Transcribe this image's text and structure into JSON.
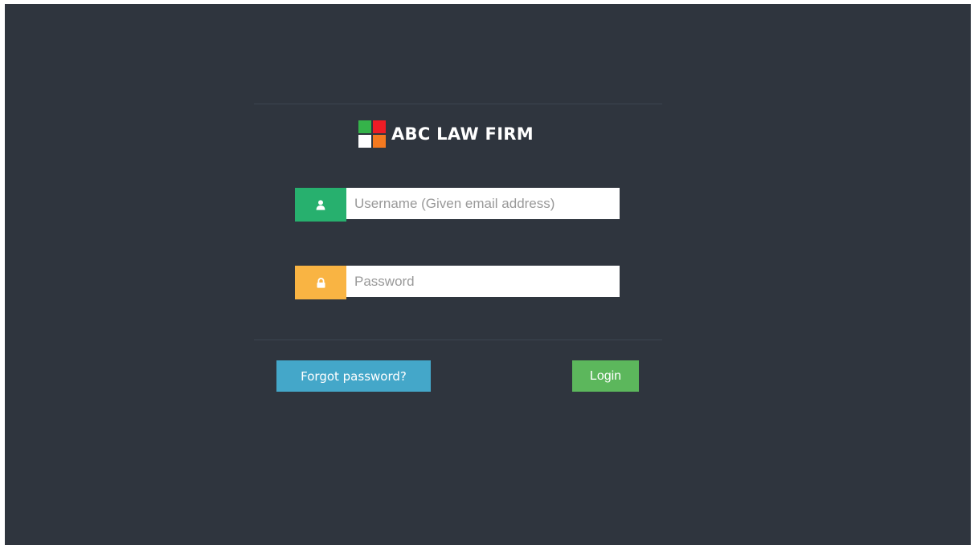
{
  "brand": {
    "name": "ABC LAW FIRM",
    "logo_colors": [
      "#35b34a",
      "#ee1c25",
      "#ffffff",
      "#f47920"
    ]
  },
  "login_form": {
    "username": {
      "icon": "user-icon",
      "placeholder": "Username (Given email address)",
      "value": ""
    },
    "password": {
      "icon": "lock-icon",
      "placeholder": "Password",
      "value": ""
    },
    "forgot_label": "Forgot password?",
    "login_label": "Login"
  },
  "colors": {
    "background": "#2f353e",
    "username_addon": "#27b06e",
    "password_addon": "#f9b443",
    "forgot_button": "#44a7c9",
    "login_button": "#5cb75c"
  }
}
